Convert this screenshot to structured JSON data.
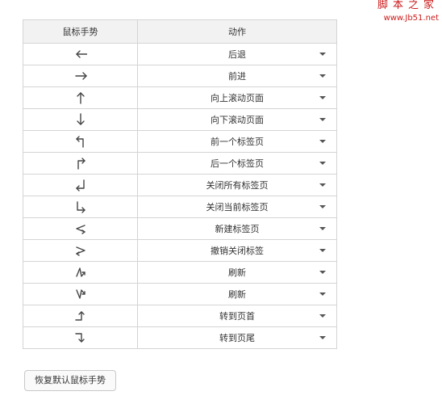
{
  "watermark": {
    "site_name": "脚本之家",
    "url": "www.Jb51.net"
  },
  "table": {
    "headers": {
      "gesture": "鼠标手势",
      "action": "动作"
    },
    "rows": [
      {
        "gesture_icon": "arrow-left-icon",
        "action": "后退"
      },
      {
        "gesture_icon": "arrow-right-icon",
        "action": "前进"
      },
      {
        "gesture_icon": "arrow-up-icon",
        "action": "向上滚动页面"
      },
      {
        "gesture_icon": "arrow-down-icon",
        "action": "向下滚动页面"
      },
      {
        "gesture_icon": "up-then-left-icon",
        "action": "前一个标签页"
      },
      {
        "gesture_icon": "up-then-right-icon",
        "action": "后一个标签页"
      },
      {
        "gesture_icon": "down-then-left-icon",
        "action": "关闭所有标签页"
      },
      {
        "gesture_icon": "down-then-right-icon",
        "action": "关闭当前标签页"
      },
      {
        "gesture_icon": "left-zigzag-icon",
        "action": "新建标签页"
      },
      {
        "gesture_icon": "right-zigzag-icon",
        "action": "撤销关闭标签"
      },
      {
        "gesture_icon": "down-up-down-icon",
        "action": "刷新"
      },
      {
        "gesture_icon": "up-down-up-icon",
        "action": "刷新"
      },
      {
        "gesture_icon": "right-then-up-icon",
        "action": "转到页首"
      },
      {
        "gesture_icon": "right-then-down-icon",
        "action": "转到页尾"
      }
    ]
  },
  "reset_button": {
    "label": "恢复默认鼠标手势"
  }
}
